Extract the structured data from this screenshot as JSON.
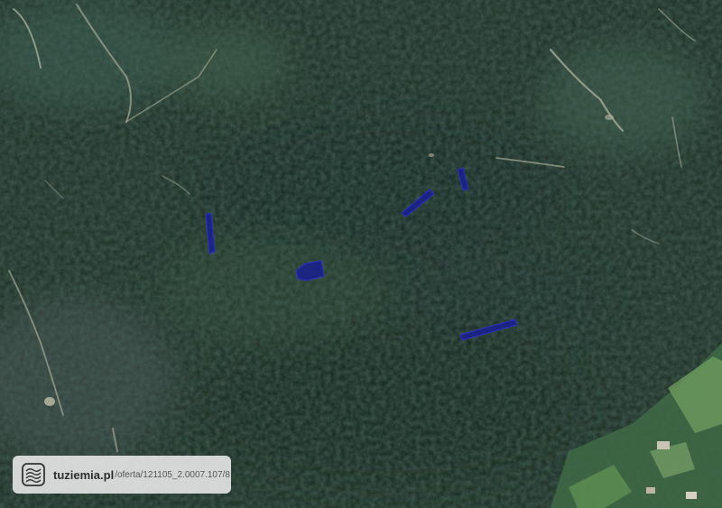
{
  "map": {
    "imagery": "satellite-forest",
    "parcel_color": "#1a1f8f"
  },
  "badge": {
    "site": "tuziemia.pl",
    "path": "/oferta/121105_2.0007.107/8",
    "icon": "tuziemia-logo-icon"
  }
}
